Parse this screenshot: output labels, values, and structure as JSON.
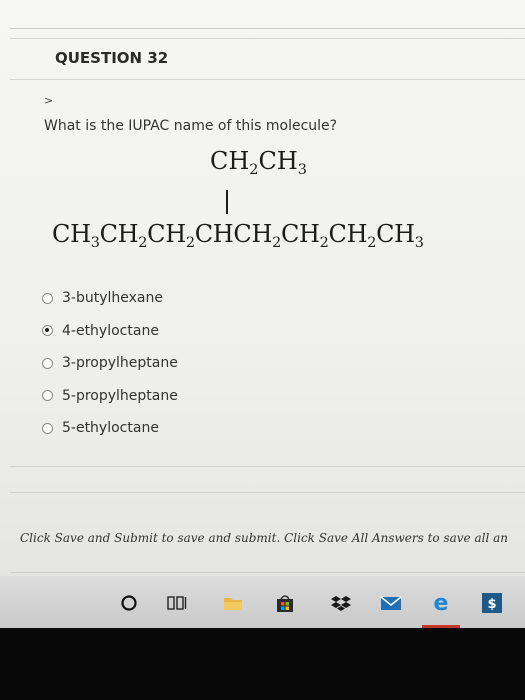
{
  "question": {
    "title": "QUESTION 32",
    "toggle": ">",
    "prompt": "What is the IUPAC name of this molecule?"
  },
  "molecule": {
    "branch": [
      "CH",
      "2",
      "CH",
      "3"
    ],
    "main_chain": [
      "CH",
      "3",
      "CH",
      "2",
      "CH",
      "2",
      "CHCH",
      "2",
      "CH",
      "2",
      "CH",
      "2",
      "CH",
      "3"
    ]
  },
  "options": [
    {
      "label": "3-butylhexane",
      "selected": false
    },
    {
      "label": "4-ethyloctane",
      "selected": true
    },
    {
      "label": "3-propylheptane",
      "selected": false
    },
    {
      "label": "5-propylheptane",
      "selected": false
    },
    {
      "label": "5-ethyloctane",
      "selected": false
    }
  ],
  "footer": {
    "note": "Click Save and Submit to save and submit. Click Save All Answers to save all an"
  },
  "taskbar": {
    "icons": [
      "cortana-icon",
      "task-view-icon",
      "file-explorer-icon",
      "store-icon",
      "dropbox-icon",
      "mail-icon",
      "edge-icon",
      "money-icon"
    ]
  },
  "colors": {
    "accent": "#c0392b",
    "folder": "#e8b64a",
    "store": "#2b2b2b",
    "mail": "#1f6fb5",
    "edge": "#1d87d6",
    "money": "#1d5a8a"
  }
}
